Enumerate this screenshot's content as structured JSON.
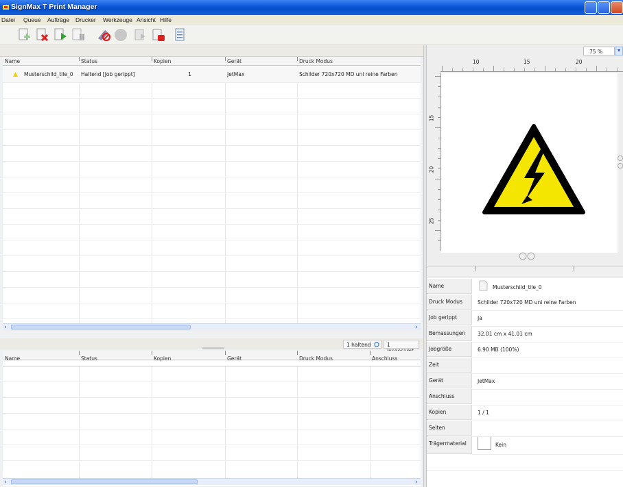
{
  "window": {
    "title": "SignMax T Print Manager"
  },
  "menu": [
    "Datei",
    "Queue",
    "Aufträge",
    "Drucker",
    "Werkzeuge",
    "Ansicht",
    "Hilfe"
  ],
  "queue_table": {
    "columns": [
      "Name",
      "Status",
      "Kopien",
      "Gerät",
      "Druck Modus"
    ],
    "rows": [
      {
        "name": "Musterschild_tile_0",
        "status": "Haltend [Job gerippt]",
        "copies": "1",
        "device": "JetMax",
        "mode": "Schilder 720x720 MD uni reine Farben"
      }
    ]
  },
  "status_bar": {
    "holding": "1 haltend",
    "total": "1 insgesamt"
  },
  "history_table": {
    "columns": [
      "Name",
      "Status",
      "Kopien",
      "Gerät",
      "Druck Modus",
      "Anschluss"
    ]
  },
  "preview": {
    "zoom": "75 %",
    "ruler_top": [
      "10",
      "15",
      "20"
    ],
    "ruler_left": [
      "15",
      "20",
      "25"
    ]
  },
  "properties": [
    {
      "label": "Name",
      "value": "Musterschild_tile_0"
    },
    {
      "label": "Druck Modus",
      "value": "Schilder 720x720 MD uni reine Farben"
    },
    {
      "label": "Job gerippt",
      "value": "Ja"
    },
    {
      "label": "Bemassungen",
      "value": "32.01 cm x 41.01 cm"
    },
    {
      "label": "Jobgröße",
      "value": "6.90 MB (100%)"
    },
    {
      "label": "Zeit",
      "value": ""
    },
    {
      "label": "Gerät",
      "value": "JetMax"
    },
    {
      "label": "Anschluss",
      "value": ""
    },
    {
      "label": "Kopien",
      "value": "1 / 1"
    },
    {
      "label": "Seiten",
      "value": ""
    },
    {
      "label": "Trägermaterial",
      "value": "Kein"
    }
  ],
  "colors": {
    "titlebar": "#0a55d8",
    "warning_yellow": "#f4e600",
    "scroll": "#c9d9f3"
  },
  "icons": [
    "app-icon",
    "add-job-icon",
    "delete-job-icon",
    "print-icon",
    "pause-icon",
    "cancel-ripping-icon",
    "stop-icon",
    "move-job-icon",
    "remove-printer-icon",
    "log-icon"
  ]
}
